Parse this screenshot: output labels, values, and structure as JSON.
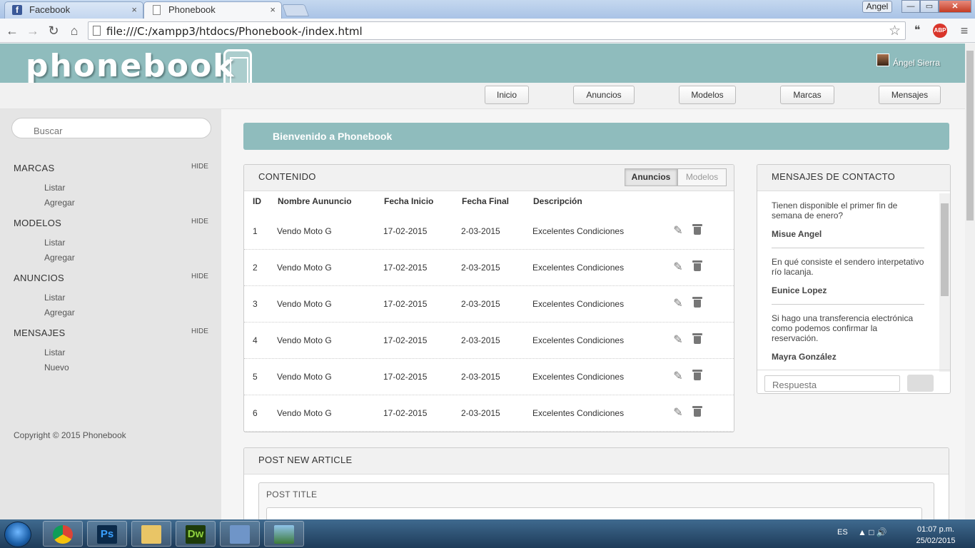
{
  "browser": {
    "tabs": [
      {
        "title": "Facebook",
        "close": "×"
      },
      {
        "title": "Phonebook",
        "close": "×"
      }
    ],
    "profile": "Angel",
    "window_controls": {
      "minimize": "—",
      "maximize": "▭",
      "close": "✕"
    },
    "url": "file:///C:/xampp3/htdocs/Phonebook-/index.html",
    "extension_abp": "ABP"
  },
  "header": {
    "logo": "phonebook",
    "user_name": "Ángel Sierra"
  },
  "nav": [
    "Inicio",
    "Anuncios",
    "Modelos",
    "Marcas",
    "Mensajes"
  ],
  "sidebar": {
    "search_placeholder": "Buscar",
    "sections": [
      {
        "title": "MARCAS",
        "hide": "HIDE",
        "links": [
          "Listar",
          "Agregar"
        ]
      },
      {
        "title": "MODELOS",
        "hide": "HIDE",
        "links": [
          "Listar",
          "Agregar"
        ]
      },
      {
        "title": "ANUNCIOS",
        "hide": "HIDE",
        "links": [
          "Listar",
          "Agregar"
        ]
      },
      {
        "title": "MENSAJES",
        "hide": "HIDE",
        "links": [
          "Listar",
          "Nuevo"
        ]
      }
    ],
    "copyright": "Copyright © 2015 Phonebook"
  },
  "welcome": "Bienvenido a Phonebook",
  "content": {
    "title": "CONTENIDO",
    "toggle": [
      "Anuncios",
      "Modelos"
    ],
    "columns": [
      "ID",
      "Nombre Aununcio",
      "Fecha Inicio",
      "Fecha Final",
      "Descripción"
    ],
    "rows": [
      {
        "id": "1",
        "name": "Vendo Moto G",
        "start": "17-02-2015",
        "end": "2-03-2015",
        "desc": "Excelentes Condiciones"
      },
      {
        "id": "2",
        "name": "Vendo Moto G",
        "start": "17-02-2015",
        "end": "2-03-2015",
        "desc": "Excelentes Condiciones"
      },
      {
        "id": "3",
        "name": "Vendo Moto G",
        "start": "17-02-2015",
        "end": "2-03-2015",
        "desc": "Excelentes Condiciones"
      },
      {
        "id": "4",
        "name": "Vendo Moto G",
        "start": "17-02-2015",
        "end": "2-03-2015",
        "desc": "Excelentes Condiciones"
      },
      {
        "id": "5",
        "name": "Vendo Moto G",
        "start": "17-02-2015",
        "end": "2-03-2015",
        "desc": "Excelentes Condiciones"
      },
      {
        "id": "6",
        "name": "Vendo Moto G",
        "start": "17-02-2015",
        "end": "2-03-2015",
        "desc": "Excelentes Condiciones"
      }
    ]
  },
  "messages": {
    "title": "MENSAJES DE CONTACTO",
    "items": [
      {
        "text": "Tienen disponible el primer fin de semana de enero?",
        "author": "Misue Angel"
      },
      {
        "text": "En qué consiste el sendero interpetativo río lacanja.",
        "author": "Eunice Lopez"
      },
      {
        "text": "Si hago una transferencia electrónica como podemos confirmar la reservación.",
        "author": "Mayra González"
      }
    ],
    "reply_placeholder": "Respuesta"
  },
  "post": {
    "title": "POST NEW ARTICLE",
    "post_title_label": "POST TITLE"
  },
  "taskbar": {
    "apps": [
      {
        "icon": "chrome-icon",
        "label": ""
      },
      {
        "icon": "photoshop-icon",
        "label": "Ps"
      },
      {
        "icon": "explorer-icon",
        "label": ""
      },
      {
        "icon": "dreamweaver-icon",
        "label": "Dw"
      },
      {
        "icon": "virtualbox-icon",
        "label": ""
      },
      {
        "icon": "image-viewer-icon",
        "label": ""
      }
    ],
    "language": "ES",
    "time": "01:07 p.m.",
    "date": "25/02/2015"
  },
  "colors": {
    "accent": "#8fbcbd",
    "sidebar": "#e5e5e5"
  }
}
